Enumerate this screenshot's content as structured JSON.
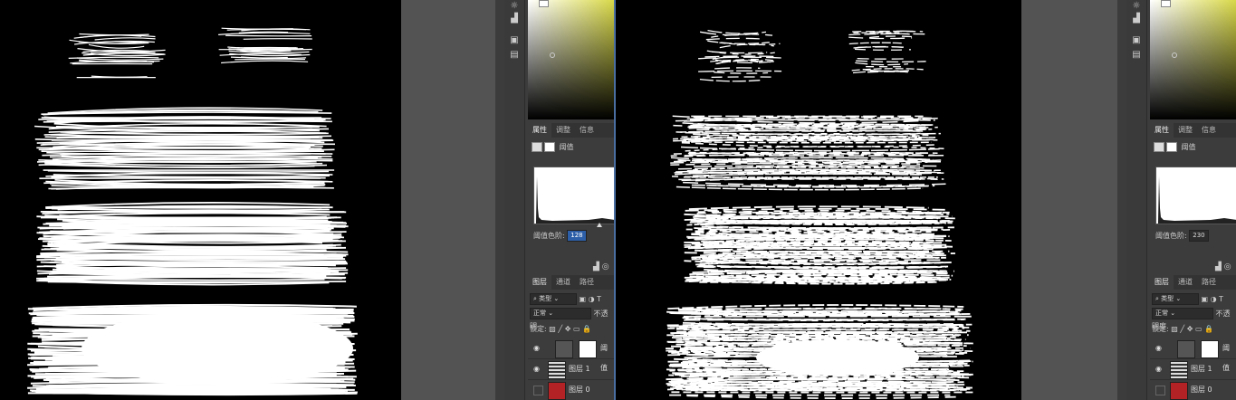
{
  "colors": {
    "canvas": "#000000",
    "workspace": "#535353",
    "panel": "#3c3c3c",
    "accent": "#2d5fa8",
    "layer0": "#b32224"
  },
  "panels": [
    {
      "tabs": [
        "属性",
        "调整",
        "信息"
      ],
      "adjustment_name": "阈值",
      "threshold_label": "阈值色阶:",
      "threshold_value": "128",
      "layer_tabs": [
        "图层",
        "通道",
        "路径"
      ],
      "kind_filter": "类型",
      "blend_mode": "正常",
      "opacity_label": "不透明",
      "lock_label": "锁定:",
      "layers": [
        {
          "name": "阈值",
          "type": "adjustment"
        },
        {
          "name": "图层 1",
          "type": "image"
        },
        {
          "name": "图层 0",
          "type": "fill"
        }
      ]
    },
    {
      "tabs": [
        "属性",
        "调整",
        "信息"
      ],
      "adjustment_name": "阈值",
      "threshold_label": "阈值色阶:",
      "threshold_value": "230",
      "layer_tabs": [
        "图层",
        "通道",
        "路径"
      ],
      "kind_filter": "类型",
      "blend_mode": "正常",
      "opacity_label": "不透明度",
      "lock_label": "锁定:",
      "layers": [
        {
          "name": "阈值",
          "type": "adjustment"
        },
        {
          "name": "图层 1",
          "type": "image"
        },
        {
          "name": "图层 0",
          "type": "fill"
        }
      ]
    }
  ]
}
